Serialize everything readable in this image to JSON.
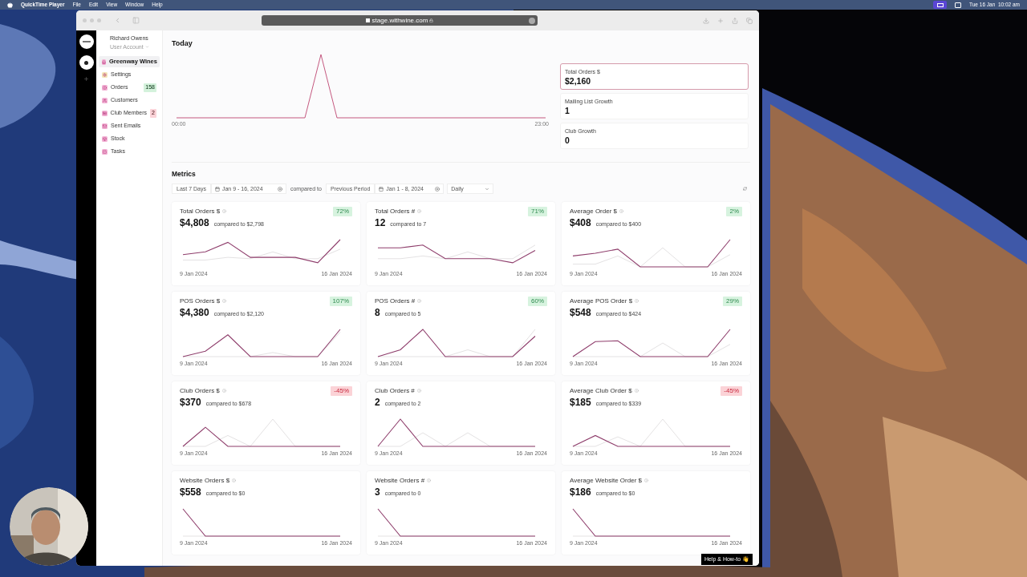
{
  "menubar": {
    "app": "QuickTime Player",
    "menus": [
      "File",
      "Edit",
      "View",
      "Window",
      "Help"
    ],
    "clock": "Tue 16 Jan  10:02 am"
  },
  "browser": {
    "url": "stage.withwine.com"
  },
  "sidebar": {
    "user": "Richard Owens",
    "role": "User Account",
    "items": [
      {
        "label": "Greenway Wines",
        "selected": true
      },
      {
        "label": "Settings",
        "selected": false
      },
      {
        "label": "Orders",
        "selected": false,
        "badge": {
          "text": "158",
          "color": "#d4f2dc"
        }
      },
      {
        "label": "Customers",
        "selected": false
      },
      {
        "label": "Club Members",
        "selected": false,
        "badge": {
          "text": "2",
          "color": "#fbd3d8"
        }
      },
      {
        "label": "Sent Emails",
        "selected": false
      },
      {
        "label": "Stock",
        "selected": false
      },
      {
        "label": "Tasks",
        "selected": false
      }
    ]
  },
  "today": {
    "title": "Today",
    "chart_start": "00:00",
    "chart_end": "23:00",
    "stats": [
      {
        "label": "Total Orders $",
        "value": "$2,160",
        "selected": true
      },
      {
        "label": "Mailing List Growth",
        "value": "1",
        "selected": false
      },
      {
        "label": "Club Growth",
        "value": "0",
        "selected": false
      }
    ]
  },
  "metrics": {
    "title": "Metrics",
    "filters": {
      "range": "Last 7 Days",
      "dates": "Jan 9 - 16, 2024",
      "compared_to": "compared to",
      "compare_range": "Previous Period",
      "compare_dates": "Jan 1 - 8, 2024",
      "interval": "Daily"
    },
    "cards": [
      {
        "title": "Total Orders $",
        "value": "$4,808",
        "compare": "compared to $2,798",
        "change": {
          "text": "72%",
          "positive": true
        },
        "start": "9 Jan 2024",
        "end": "16 Jan 2024"
      },
      {
        "title": "Total Orders #",
        "value": "12",
        "compare": "compared to 7",
        "change": {
          "text": "71%",
          "positive": true
        },
        "start": "9 Jan 2024",
        "end": "16 Jan 2024"
      },
      {
        "title": "Average Order $",
        "value": "$408",
        "compare": "compared to $400",
        "change": {
          "text": "2%",
          "positive": true
        },
        "start": "9 Jan 2024",
        "end": "16 Jan 2024"
      },
      {
        "title": "POS Orders $",
        "value": "$4,380",
        "compare": "compared to $2,120",
        "change": {
          "text": "107%",
          "positive": true
        },
        "start": "9 Jan 2024",
        "end": "16 Jan 2024"
      },
      {
        "title": "POS Orders #",
        "value": "8",
        "compare": "compared to 5",
        "change": {
          "text": "60%",
          "positive": true
        },
        "start": "9 Jan 2024",
        "end": "16 Jan 2024"
      },
      {
        "title": "Average POS Order $",
        "value": "$548",
        "compare": "compared to $424",
        "change": {
          "text": "29%",
          "positive": true
        },
        "start": "9 Jan 2024",
        "end": "16 Jan 2024"
      },
      {
        "title": "Club Orders $",
        "value": "$370",
        "compare": "compared to $678",
        "change": {
          "text": "-45%",
          "positive": false
        },
        "start": "9 Jan 2024",
        "end": "16 Jan 2024"
      },
      {
        "title": "Club Orders #",
        "value": "2",
        "compare": "compared to 2",
        "start": "9 Jan 2024",
        "end": "16 Jan 2024"
      },
      {
        "title": "Average Club Order $",
        "value": "$185",
        "compare": "compared to $339",
        "change": {
          "text": "-45%",
          "positive": false
        },
        "start": "9 Jan 2024",
        "end": "16 Jan 2024"
      },
      {
        "title": "Website Orders $",
        "value": "$558",
        "compare": "compared to $0",
        "start": "9 Jan 2024",
        "end": "16 Jan 2024"
      },
      {
        "title": "Website Orders #",
        "value": "3",
        "compare": "compared to 0",
        "start": "9 Jan 2024",
        "end": "16 Jan 2024"
      },
      {
        "title": "Average Website Order $",
        "value": "$186",
        "compare": "compared to $0",
        "start": "9 Jan 2024",
        "end": "16 Jan 2024"
      }
    ]
  },
  "help": "Help & How-to 👋"
}
